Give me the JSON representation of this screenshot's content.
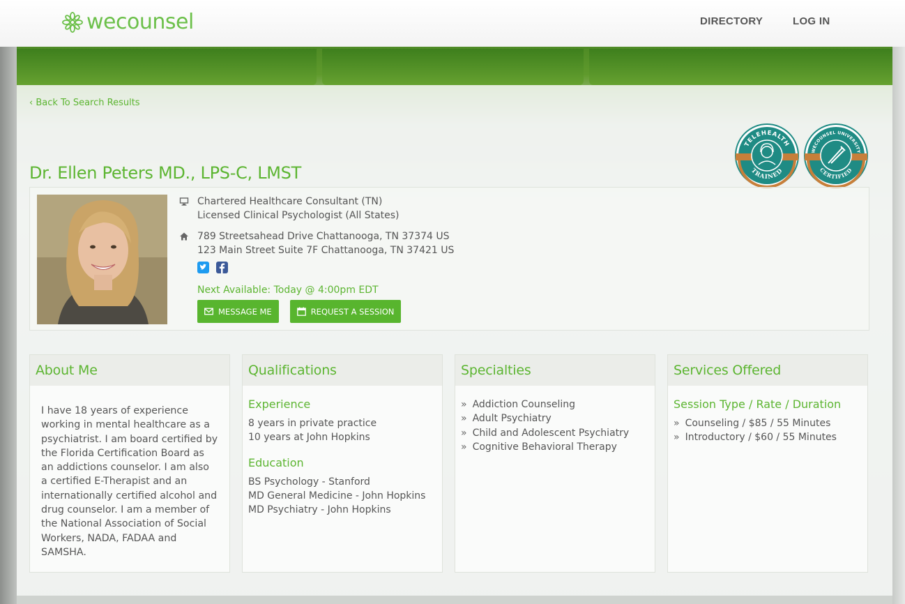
{
  "header": {
    "logo_text": "wecounsel",
    "nav": {
      "directory": "DIRECTORY",
      "login": "LOG IN"
    }
  },
  "back_link": "‹ Back To Search Results",
  "badges": {
    "telehealth": {
      "top": "TELEHEALTH",
      "bottom": "TRAINED"
    },
    "university": {
      "top": "WECOUNSEL UNIVERSITY",
      "bottom": "CERTIFIED"
    }
  },
  "profile": {
    "name": "Dr. Ellen Peters MD., LPS-C, LMST",
    "titles": [
      "Chartered Healthcare Consultant (TN)",
      "Licensed Clinical Psychologist (All States)"
    ],
    "addresses": [
      "789 Streetsahead Drive Chattanooga, TN 37374 US",
      "123 Main Street Suite 7F Chattanooga, TN 37421 US"
    ],
    "next_available": "Next Available: Today @ 4:00pm EDT",
    "buttons": {
      "message": "MESSAGE ME",
      "request": "REQUEST A SESSION"
    }
  },
  "panels": {
    "about": {
      "title": "About Me",
      "text": "I have 18 years of experience working in mental healthcare as a psychiatrist. I am board certified by the Florida Certification Board as an addictions counselor. I am also a certified E-Therapist and an internationally certified alcohol and drug counselor. I am a member of the National Association of Social Workers, NADA, FADAA and SAMSHA."
    },
    "qualifications": {
      "title": "Qualifications",
      "experience_title": "Experience",
      "experience": [
        "8 years in private practice",
        "10 years at John Hopkins"
      ],
      "education_title": "Education",
      "education": [
        "BS Psychology - Stanford",
        "MD General Medicine - John Hopkins",
        "MD Psychiatry - John Hopkins"
      ]
    },
    "specialties": {
      "title": "Specialties",
      "items": [
        "Addiction Counseling",
        "Adult Psychiatry",
        "Child and Adolescent Psychiatry",
        "Cognitive Behavioral Therapy"
      ]
    },
    "services": {
      "title": "Services Offered",
      "subtitle": "Session Type / Rate / Duration",
      "items": [
        "Counseling / $85 / 55 Minutes",
        "Introductory / $60 / 55 Minutes"
      ]
    }
  },
  "colors": {
    "brand_green": "#5cb531",
    "button_green": "#58b52e",
    "badge_teal": "#1f8b84",
    "badge_orange": "#c77f3a",
    "twitter": "#1d9bf0",
    "facebook": "#3b5998"
  }
}
